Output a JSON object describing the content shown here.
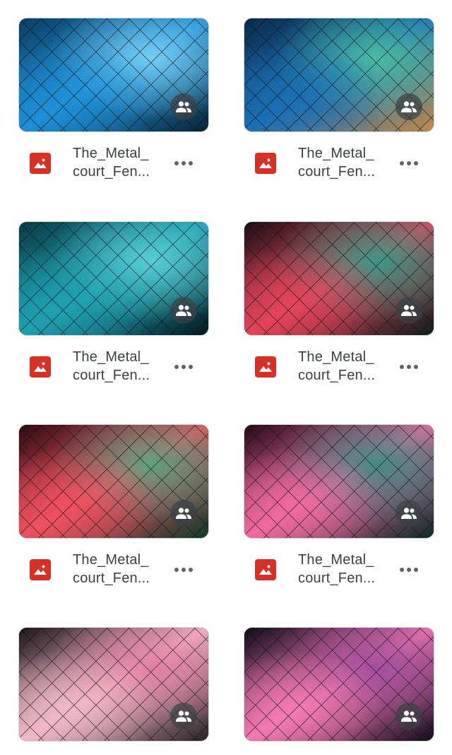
{
  "files": [
    {
      "name_line1": "The_Metal_",
      "name_line2": "court_Fen...",
      "type_icon": "image-file-icon",
      "shared_icon": "shared-people-icon",
      "menu_icon": "more-horizontal-icon",
      "colors": [
        "#0b3d63",
        "#1e8fd6",
        "#7fd3f5",
        "#0a2436"
      ]
    },
    {
      "name_line1": "The_Metal_",
      "name_line2": "court_Fen...",
      "type_icon": "image-file-icon",
      "shared_icon": "shared-people-icon",
      "menu_icon": "more-horizontal-icon",
      "colors": [
        "#0a2a4a",
        "#1b6fb5",
        "#4fc3a1",
        "#c08a4a"
      ]
    },
    {
      "name_line1": "The_Metal_",
      "name_line2": "court_Fen...",
      "type_icon": "image-file-icon",
      "shared_icon": "shared-people-icon",
      "menu_icon": "more-horizontal-icon",
      "colors": [
        "#0a3a44",
        "#1ea0b0",
        "#5fd0d8",
        "#041820"
      ]
    },
    {
      "name_line1": "The_Metal_",
      "name_line2": "court_Fen...",
      "type_icon": "image-file-icon",
      "shared_icon": "shared-people-icon",
      "menu_icon": "more-horizontal-icon",
      "colors": [
        "#1a0f14",
        "#e2445a",
        "#2aa08a",
        "#0b1e1c"
      ]
    },
    {
      "name_line1": "The_Metal_",
      "name_line2": "court_Fen...",
      "type_icon": "image-file-icon",
      "shared_icon": "shared-people-icon",
      "menu_icon": "more-horizontal-icon",
      "colors": [
        "#2a0a10",
        "#ef5060",
        "#4fa882",
        "#0d3a2a"
      ]
    },
    {
      "name_line1": "The_Metal_",
      "name_line2": "court_Fen...",
      "type_icon": "image-file-icon",
      "shared_icon": "shared-people-icon",
      "menu_icon": "more-horizontal-icon",
      "colors": [
        "#240a18",
        "#f06aa0",
        "#2f8f80",
        "#0b2a28"
      ]
    },
    {
      "name_line1": "",
      "name_line2": "",
      "type_icon": "image-file-icon",
      "shared_icon": "shared-people-icon",
      "menu_icon": "more-horizontal-icon",
      "colors": [
        "#1a1418",
        "#f2b8c8",
        "#e07aa0",
        "#2a2226"
      ]
    },
    {
      "name_line1": "",
      "name_line2": "",
      "type_icon": "image-file-icon",
      "shared_icon": "shared-people-icon",
      "menu_icon": "more-horizontal-icon",
      "colors": [
        "#0d0a18",
        "#f27ab0",
        "#9a4a9a",
        "#120c1c"
      ]
    }
  ]
}
